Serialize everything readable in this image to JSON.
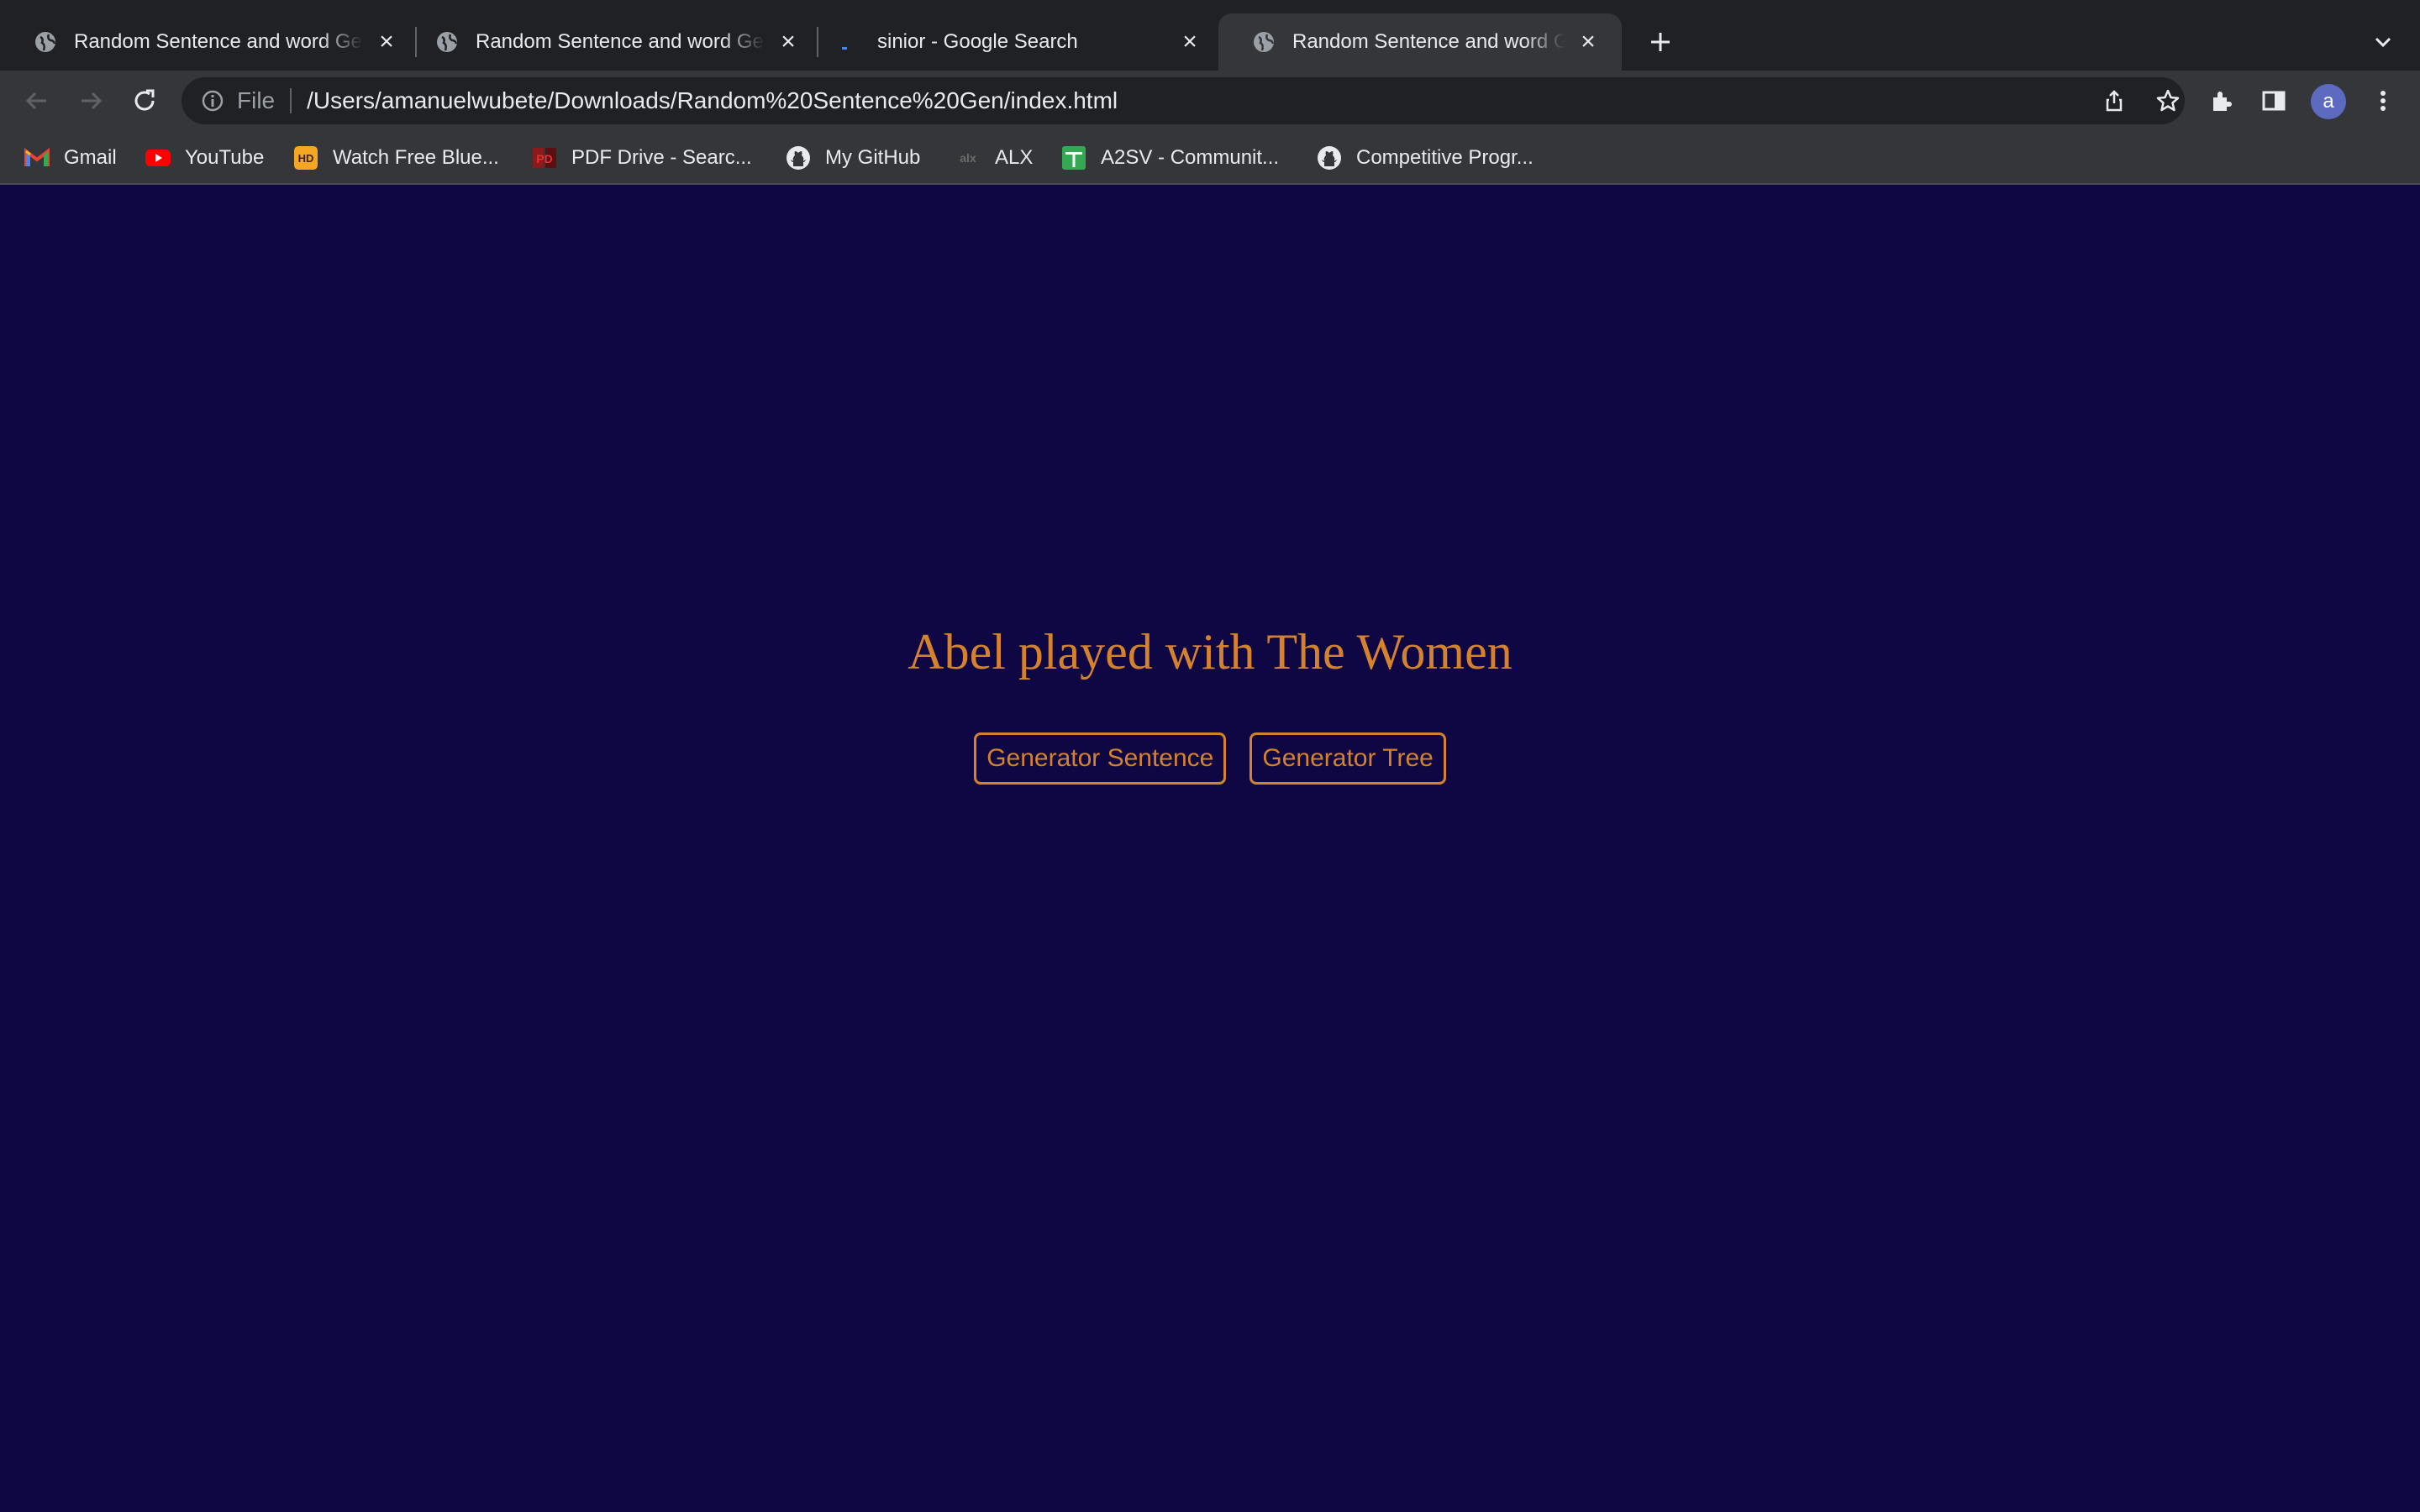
{
  "tabs": [
    {
      "title": "Random Sentence and word Generator",
      "favicon": "globe-icon",
      "active": false
    },
    {
      "title": "Random Sentence and word Generator",
      "favicon": "globe-icon",
      "active": false
    },
    {
      "title": "sinior - Google Search",
      "favicon": "loading-icon",
      "active": false
    },
    {
      "title": "Random Sentence and word Generator",
      "favicon": "globe-icon",
      "active": true
    }
  ],
  "omnibox": {
    "scheme_label": "File",
    "url": "/Users/amanuelwubete/Downloads/Random%20Sentence%20Gen/index.html"
  },
  "profile": {
    "initial": "a",
    "color": "#5c6bc0"
  },
  "bookmarks": [
    {
      "label": "Gmail",
      "icon": "gmail-icon"
    },
    {
      "label": "YouTube",
      "icon": "youtube-icon"
    },
    {
      "label": "Watch Free Blue...",
      "icon": "hd-icon"
    },
    {
      "label": "PDF Drive - Searc...",
      "icon": "pdf-drive-icon"
    },
    {
      "label": "My GitHub",
      "icon": "github-icon"
    },
    {
      "label": "ALX",
      "icon": "alx-icon"
    },
    {
      "label": "A2SV - Communit...",
      "icon": "a2sv-icon"
    },
    {
      "label": "Competitive Progr...",
      "icon": "github-icon"
    }
  ],
  "page": {
    "sentence": "Abel played with The Women",
    "buttons": {
      "sentence_label": "Generator Sentence",
      "tree_label": "Generator Tree"
    },
    "colors": {
      "background": "#0f0743",
      "accent": "#d4822e"
    }
  }
}
